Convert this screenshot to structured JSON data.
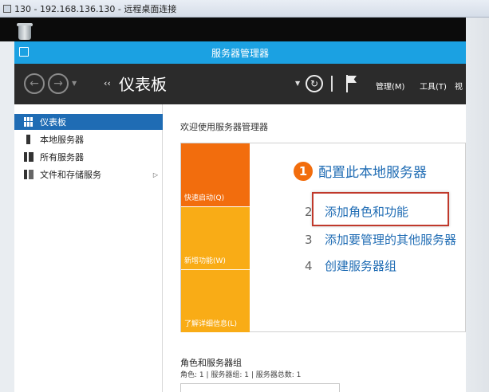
{
  "rdp": {
    "title": "130 - 192.168.136.130 - 远程桌面连接"
  },
  "window": {
    "title": "服务器管理器"
  },
  "toolbar": {
    "breadcrumb_arrows": "‹‹",
    "breadcrumb": "仪表板",
    "menu_manage": "管理(M)",
    "menu_tools": "工具(T)",
    "menu_view": "视"
  },
  "sidebar": {
    "items": [
      {
        "label": "仪表板",
        "icon": "dashboard-icon",
        "active": true
      },
      {
        "label": "本地服务器",
        "icon": "server-icon",
        "active": false
      },
      {
        "label": "所有服务器",
        "icon": "servers-icon",
        "active": false
      },
      {
        "label": "文件和存储服务",
        "icon": "storage-icon",
        "active": false,
        "has_arrow": true
      }
    ]
  },
  "main": {
    "welcome": "欢迎使用服务器管理器",
    "tiles": [
      {
        "label": "快速启动(Q)",
        "color": "#f26d0d"
      },
      {
        "label": "新增功能(W)",
        "color": "#f9ac16"
      },
      {
        "label": "了解详细信息(L)",
        "color": "#f9ac16"
      }
    ],
    "steps": {
      "main_number": "1",
      "main_label": "配置此本地服务器",
      "items": [
        {
          "number": "2",
          "label": "添加角色和功能"
        },
        {
          "number": "3",
          "label": "添加要管理的其他服务器"
        },
        {
          "number": "4",
          "label": "创建服务器组"
        }
      ]
    },
    "roles_section": {
      "title": "角色和服务器组",
      "subtitle": "角色: 1 | 服务器组: 1 | 服务器总数: 1"
    }
  },
  "colors": {
    "accent_blue": "#1ba1e2",
    "nav_active": "#1f6cb4",
    "tile_orange": "#f26d0d",
    "tile_yellow": "#f9ac16",
    "highlight_red": "#c0392b"
  }
}
